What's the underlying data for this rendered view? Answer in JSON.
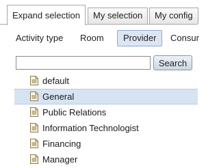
{
  "tabs": [
    {
      "label": "Expand selection",
      "active": true
    },
    {
      "label": "My selection",
      "active": false
    },
    {
      "label": "My config",
      "active": false
    }
  ],
  "subtabs": [
    {
      "label": "Activity type",
      "active": false
    },
    {
      "label": "Room",
      "active": false
    },
    {
      "label": "Provider",
      "active": true
    },
    {
      "label": "Consur",
      "active": false
    }
  ],
  "search": {
    "value": "",
    "placeholder": "",
    "button_label": "Search"
  },
  "list": {
    "icon": "document-icon",
    "items": [
      {
        "label": "default",
        "selected": false
      },
      {
        "label": "General",
        "selected": true
      },
      {
        "label": "Public Relations",
        "selected": false
      },
      {
        "label": "Information Technologist",
        "selected": false
      },
      {
        "label": "Financing",
        "selected": false
      },
      {
        "label": "Manager",
        "selected": false
      }
    ]
  },
  "colors": {
    "selected_background": "#d6e3f2",
    "active_subtab_background": "#dce5f3",
    "tab_border": "#a7a7a7"
  }
}
